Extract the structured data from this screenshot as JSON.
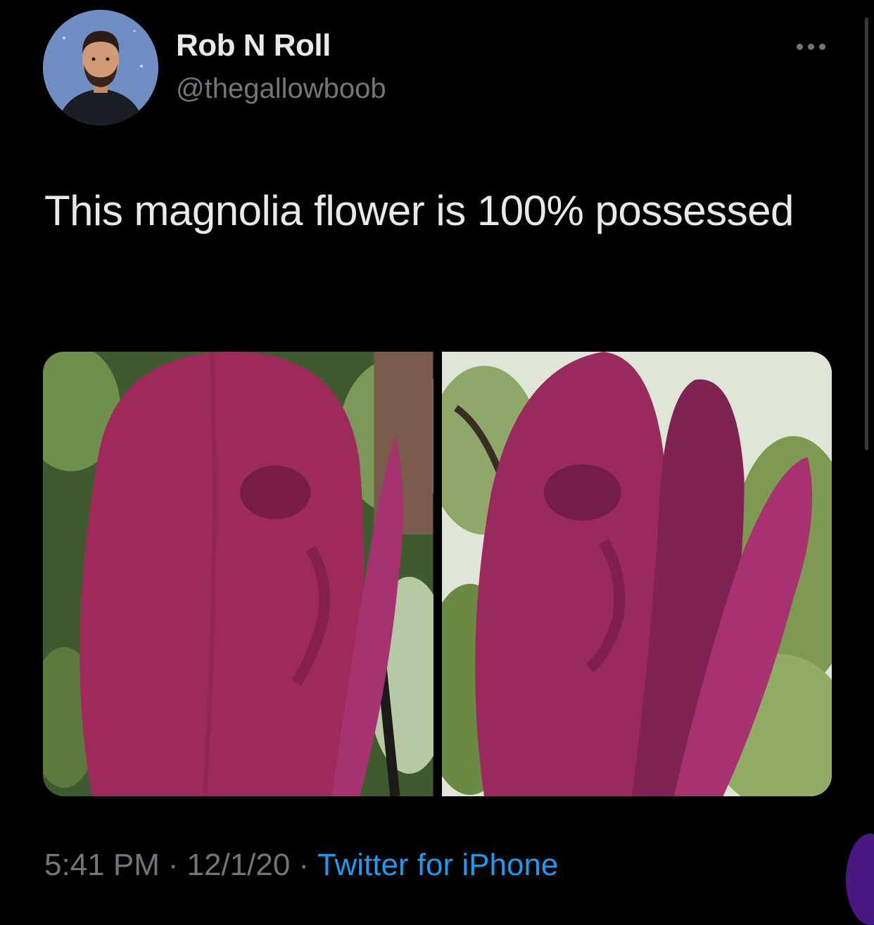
{
  "tweet": {
    "author": {
      "display_name": "Rob N Roll",
      "handle": "@thegallowboob",
      "avatar_icon": "avatar-icon"
    },
    "more_icon": "more-options-icon",
    "text": "This magnolia flower is 100% possessed",
    "media": [
      {
        "icon": "magnolia-photo-icon"
      },
      {
        "icon": "magnolia-photo-icon"
      }
    ],
    "footer": {
      "time": "5:41 PM",
      "date": "12/1/20",
      "separator": "·",
      "source": "Twitter for iPhone"
    }
  },
  "colors": {
    "background": "#000000",
    "primary_text": "#e7e9ea",
    "secondary_text": "#71767b",
    "link": "#1d9bf0"
  }
}
